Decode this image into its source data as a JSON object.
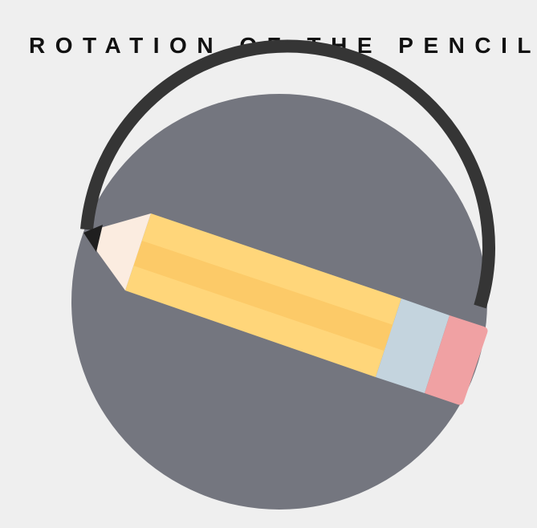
{
  "page": {
    "title": "ROTATION OF THE PENCIL"
  },
  "colors": {
    "background": "#efefef",
    "title": "#111111",
    "disc": "#74767f",
    "ring": "#353535",
    "pencil_body": "#ffd67a",
    "pencil_stripe": "#fcca68",
    "pencil_ferrule": "#c4d4de",
    "pencil_eraser": "#f0a1a3",
    "pencil_wood": "#fbece0",
    "pencil_lead": "#1f1f1f"
  },
  "icons": {
    "pencil": "pencil-icon",
    "disc": "circle"
  }
}
